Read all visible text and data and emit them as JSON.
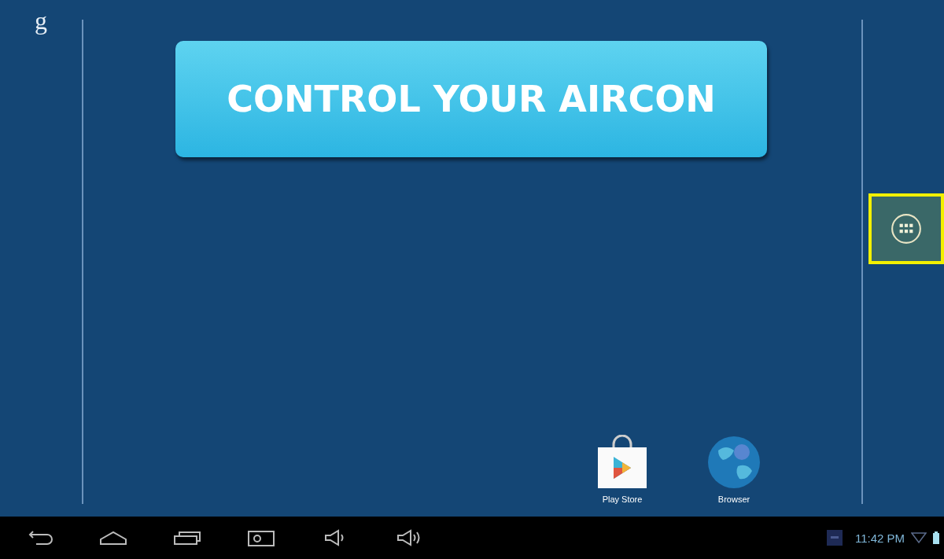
{
  "search_button": {
    "label": "g"
  },
  "banner_button": {
    "label": "CONTROL YOUR AIRCON"
  },
  "apps_button": {
    "highlighted": true
  },
  "dock": [
    {
      "kind": "store",
      "label": "Play Store"
    },
    {
      "kind": "globe",
      "label": "Browser"
    }
  ],
  "status_bar": {
    "time": "11:42 PM"
  }
}
